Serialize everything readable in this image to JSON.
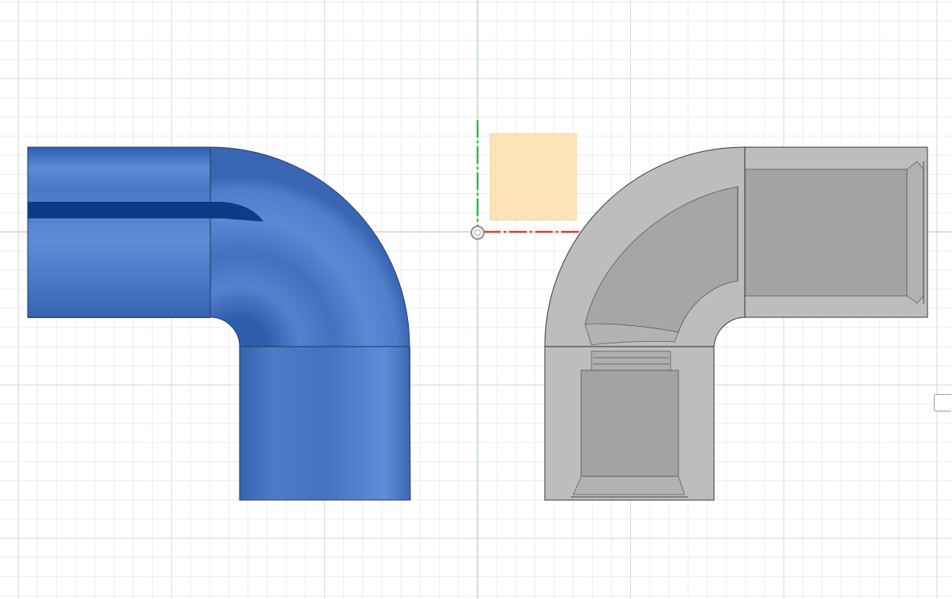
{
  "app": {
    "view": "sketch-grid-viewport"
  },
  "colors": {
    "background": "#ffffff",
    "grid_minor": "#ececec",
    "grid_major": "#d8d8d8",
    "axis_x": "#e23b2b",
    "axis_y": "#2fb94a",
    "axis_y_line": "#9ad9a4",
    "pipe_blue": "#3f6fbe",
    "pipe_blue_highlight": "#6b98db",
    "pipe_blue_dark": "#123f8a",
    "fitting_outer": "#bdbdbd",
    "fitting_inner": "#a3a3a3",
    "edge": "#2a2a2a",
    "origin_plane": "#fde2b3"
  },
  "objects": [
    {
      "name": "blue-pipe-elbow",
      "kind": "solid-body"
    },
    {
      "name": "section-view-fitting",
      "kind": "section-body"
    },
    {
      "name": "origin-plane",
      "kind": "construction-plane"
    },
    {
      "name": "origin-point",
      "kind": "construction-point"
    }
  ],
  "icons": [
    "origin-point-icon",
    "view-cube-handle-icon"
  ]
}
